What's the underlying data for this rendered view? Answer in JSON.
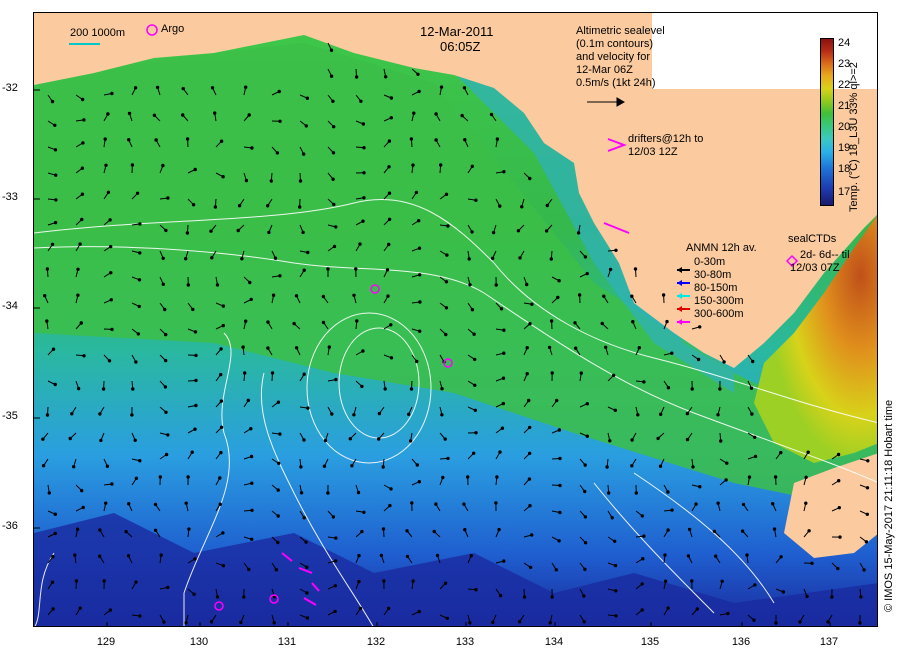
{
  "title": {
    "date": "12-Mar-2011",
    "time": "06:05Z"
  },
  "scale_legend": {
    "label": "200  1000m",
    "argo_label": "Argo"
  },
  "altimetry_note": [
    "Altimetric sealevel",
    "(0.1m contours)",
    "and velocity for",
    "12-Mar 06Z",
    "0.5m/s (1kt 24h)"
  ],
  "drifters_note": [
    "drifters@12h to",
    "12/03 12Z"
  ],
  "anmn": {
    "title": "ANMN 12h av.",
    "items": [
      {
        "label": "0-30m",
        "color": "#000000"
      },
      {
        "label": "30-80m",
        "color": "#0000ff"
      },
      {
        "label": "80-150m",
        "color": "#00e5e5"
      },
      {
        "label": "150-300m",
        "color": "#e00000"
      },
      {
        "label": "300-600m",
        "color": "#ff00ff"
      }
    ]
  },
  "sealctd": [
    "sealCTDs",
    "2d- 6d-- til",
    "12/03 07Z"
  ],
  "colorbar": {
    "ticks": [
      "24",
      "23",
      "22",
      "21",
      "20",
      "19",
      "18",
      "17"
    ],
    "label": "Temp. (°C) 18_L3U 33% ql>=2"
  },
  "credit": "© IMOS 15-May-2017 21:11:18 Hobart time",
  "axes": {
    "y_ticks": [
      "-32",
      "-33",
      "-34",
      "-35",
      "-36"
    ],
    "x_ticks": [
      "129",
      "130",
      "131",
      "132",
      "133",
      "134",
      "135",
      "136",
      "137"
    ]
  },
  "colors": {
    "land": "#fbcb9f",
    "argo": "#ff00ff",
    "contour": "#ffffff"
  }
}
